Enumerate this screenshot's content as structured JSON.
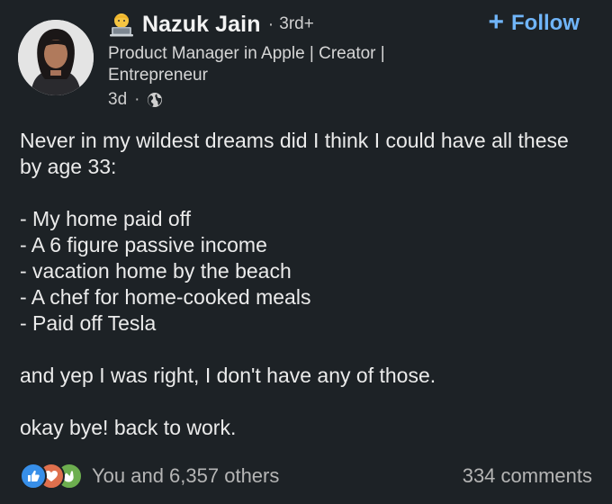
{
  "author": {
    "name": "Nazuk Jain",
    "separator": "·",
    "degree": "3rd+",
    "headline": "Product Manager in Apple | Creator | Entrepreneur",
    "posted_ago": "3d",
    "meta_separator": "·",
    "visibility_icon": "globe-icon",
    "badge_icon": "technologist-emoji-icon"
  },
  "follow": {
    "icon": "plus-icon",
    "label": "Follow"
  },
  "post": {
    "intro": "Never in my wildest dreams did I think I could have all these by age 33:",
    "list": [
      "- My home paid off",
      "- A 6 figure passive income",
      "- vacation home by the beach",
      "- A chef for home-cooked meals",
      "- Paid off Tesla"
    ],
    "punchline": "and yep I was right, I don't have any of those.",
    "closing": "okay bye! back to work."
  },
  "social": {
    "reaction_icons": [
      "like-icon",
      "love-icon",
      "celebrate-icon"
    ],
    "reactions_text": "You and 6,357 others",
    "comments_text": "334 comments"
  },
  "colors": {
    "background": "#1d2226",
    "link_blue": "#70b5f9",
    "like_blue": "#378fe9",
    "love_red": "#df704d",
    "celebrate_green": "#6dae4f"
  }
}
